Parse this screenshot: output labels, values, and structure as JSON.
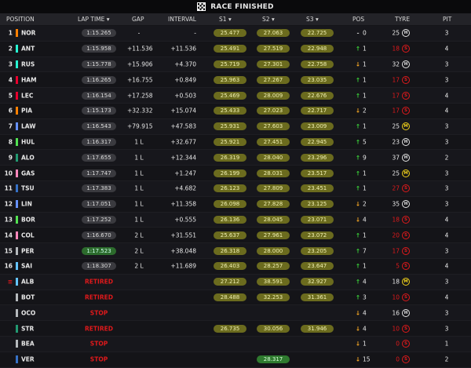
{
  "title": "RACE FINISHED",
  "headers": {
    "position": "POSITION",
    "lap_time": "LAP TIME",
    "gap": "GAP",
    "interval": "INTERVAL",
    "s1": "S1",
    "s2": "S2",
    "s3": "S3",
    "pos": "POS",
    "tyre": "TYRE",
    "pit": "PIT"
  },
  "colors": {
    "mclaren": "#ff8000",
    "ferrari": "#e8002d",
    "mercedes": "#27f4d2",
    "redbull": "#3671c6",
    "williams": "#64c4ff",
    "haas": "#b6babd",
    "alpine": "#ff87bc",
    "sauber": "#52e252",
    "astonmartin": "#229971",
    "racingbulls": "#6692ff"
  },
  "rows": [
    {
      "pos": "1",
      "code": "NOR",
      "team": "#ff8000",
      "lap": "1:15.265",
      "lap_style": "",
      "gap": "-",
      "interval": "-",
      "s1": "25.477",
      "s1c": "y",
      "s2": "27.063",
      "s2c": "y",
      "s3": "22.725",
      "s3c": "y",
      "arrow": "-",
      "dir": "none",
      "chg": "0",
      "laps": "25",
      "tyre": "H",
      "pit": "3"
    },
    {
      "pos": "2",
      "code": "ANT",
      "team": "#27f4d2",
      "lap": "1:15.958",
      "lap_style": "",
      "gap": "+11.536",
      "interval": "+11.536",
      "s1": "25.491",
      "s1c": "y",
      "s2": "27.519",
      "s2c": "y",
      "s3": "22.948",
      "s3c": "y",
      "arrow": "↑",
      "dir": "up",
      "chg": "1",
      "laps": "18",
      "tyre": "S",
      "pit": "4"
    },
    {
      "pos": "3",
      "code": "RUS",
      "team": "#27f4d2",
      "lap": "1:15.778",
      "lap_style": "",
      "gap": "+15.906",
      "interval": "+4.370",
      "s1": "25.719",
      "s1c": "y",
      "s2": "27.301",
      "s2c": "y",
      "s3": "22.758",
      "s3c": "y",
      "arrow": "↓",
      "dir": "down",
      "chg": "1",
      "laps": "32",
      "tyre": "H",
      "pit": "3"
    },
    {
      "pos": "4",
      "code": "HAM",
      "team": "#e8002d",
      "lap": "1:16.265",
      "lap_style": "",
      "gap": "+16.755",
      "interval": "+0.849",
      "s1": "25.963",
      "s1c": "y",
      "s2": "27.267",
      "s2c": "y",
      "s3": "23.035",
      "s3c": "y",
      "arrow": "↑",
      "dir": "up",
      "chg": "1",
      "laps": "17",
      "tyre": "S",
      "pit": "3"
    },
    {
      "pos": "5",
      "code": "LEC",
      "team": "#e8002d",
      "lap": "1:16.154",
      "lap_style": "",
      "gap": "+17.258",
      "interval": "+0.503",
      "s1": "25.469",
      "s1c": "y",
      "s2": "28.009",
      "s2c": "y",
      "s3": "22.676",
      "s3c": "y",
      "arrow": "↑",
      "dir": "up",
      "chg": "1",
      "laps": "17",
      "tyre": "S",
      "pit": "4"
    },
    {
      "pos": "6",
      "code": "PIA",
      "team": "#ff8000",
      "lap": "1:15.173",
      "lap_style": "",
      "gap": "+32.332",
      "interval": "+15.074",
      "s1": "25.433",
      "s1c": "y",
      "s2": "27.023",
      "s2c": "y",
      "s3": "22.717",
      "s3c": "y",
      "arrow": "↓",
      "dir": "down",
      "chg": "2",
      "laps": "17",
      "tyre": "S",
      "pit": "4"
    },
    {
      "pos": "7",
      "code": "LAW",
      "team": "#6692ff",
      "lap": "1:16.543",
      "lap_style": "",
      "gap": "+79.915",
      "interval": "+47.583",
      "s1": "25.931",
      "s1c": "y",
      "s2": "27.603",
      "s2c": "y",
      "s3": "23.009",
      "s3c": "y",
      "arrow": "↑",
      "dir": "up",
      "chg": "1",
      "laps": "25",
      "tyre": "M",
      "pit": "3"
    },
    {
      "pos": "8",
      "code": "HUL",
      "team": "#52e252",
      "lap": "1:16.317",
      "lap_style": "",
      "gap": "1 L",
      "interval": "+32.677",
      "s1": "25.921",
      "s1c": "y",
      "s2": "27.451",
      "s2c": "y",
      "s3": "22.945",
      "s3c": "y",
      "arrow": "↑",
      "dir": "up",
      "chg": "5",
      "laps": "23",
      "tyre": "H",
      "pit": "3"
    },
    {
      "pos": "9",
      "code": "ALO",
      "team": "#229971",
      "lap": "1:17.655",
      "lap_style": "",
      "gap": "1 L",
      "interval": "+12.344",
      "s1": "26.319",
      "s1c": "y",
      "s2": "28.040",
      "s2c": "y",
      "s3": "23.296",
      "s3c": "y",
      "arrow": "↑",
      "dir": "up",
      "chg": "9",
      "laps": "37",
      "tyre": "H",
      "pit": "2"
    },
    {
      "pos": "10",
      "code": "GAS",
      "team": "#ff87bc",
      "lap": "1:17.747",
      "lap_style": "",
      "gap": "1 L",
      "interval": "+1.247",
      "s1": "26.199",
      "s1c": "y",
      "s2": "28.031",
      "s2c": "y",
      "s3": "23.517",
      "s3c": "y",
      "arrow": "↑",
      "dir": "up",
      "chg": "1",
      "laps": "25",
      "tyre": "M",
      "pit": "3"
    },
    {
      "pos": "11",
      "code": "TSU",
      "team": "#3671c6",
      "lap": "1:17.383",
      "lap_style": "",
      "gap": "1 L",
      "interval": "+4.682",
      "s1": "26.123",
      "s1c": "y",
      "s2": "27.809",
      "s2c": "y",
      "s3": "23.451",
      "s3c": "y",
      "arrow": "↑",
      "dir": "up",
      "chg": "1",
      "laps": "27",
      "tyre": "S",
      "pit": "3"
    },
    {
      "pos": "12",
      "code": "LIN",
      "team": "#6692ff",
      "lap": "1:17.051",
      "lap_style": "",
      "gap": "1 L",
      "interval": "+11.358",
      "s1": "26.098",
      "s1c": "y",
      "s2": "27.828",
      "s2c": "y",
      "s3": "23.125",
      "s3c": "y",
      "arrow": "↓",
      "dir": "down",
      "chg": "2",
      "laps": "35",
      "tyre": "H",
      "pit": "3"
    },
    {
      "pos": "13",
      "code": "BOR",
      "team": "#52e252",
      "lap": "1:17.252",
      "lap_style": "",
      "gap": "1 L",
      "interval": "+0.555",
      "s1": "26.136",
      "s1c": "y",
      "s2": "28.045",
      "s2c": "y",
      "s3": "23.071",
      "s3c": "y",
      "arrow": "↓",
      "dir": "down",
      "chg": "4",
      "laps": "18",
      "tyre": "S",
      "pit": "4"
    },
    {
      "pos": "14",
      "code": "COL",
      "team": "#ff87bc",
      "lap": "1:16.670",
      "lap_style": "",
      "gap": "2 L",
      "interval": "+31.551",
      "s1": "25.637",
      "s1c": "y",
      "s2": "27.961",
      "s2c": "y",
      "s3": "23.072",
      "s3c": "y",
      "arrow": "↑",
      "dir": "up",
      "chg": "1",
      "laps": "20",
      "tyre": "S",
      "pit": "4"
    },
    {
      "pos": "15",
      "code": "PER",
      "team": "#b6babd",
      "lap": "1:17.523",
      "lap_style": "fast",
      "gap": "2 L",
      "interval": "+38.048",
      "s1": "26.318",
      "s1c": "y",
      "s2": "28.000",
      "s2c": "y",
      "s3": "23.205",
      "s3c": "y",
      "arrow": "↑",
      "dir": "up",
      "chg": "7",
      "laps": "17",
      "tyre": "S",
      "pit": "3"
    },
    {
      "pos": "16",
      "code": "SAI",
      "team": "#64c4ff",
      "lap": "1:18.307",
      "lap_style": "",
      "gap": "2 L",
      "interval": "+11.689",
      "s1": "26.403",
      "s1c": "y",
      "s2": "28.257",
      "s2c": "y",
      "s3": "23.647",
      "s3c": "y",
      "arrow": "↑",
      "dir": "up",
      "chg": "1",
      "laps": "5",
      "tyre": "S",
      "pit": "4"
    },
    {
      "pos": "",
      "code": "ALB",
      "team": "#64c4ff",
      "lap": "RETIRED",
      "lap_style": "status",
      "gap": "",
      "interval": "",
      "s1": "",
      "s1c": "",
      "s2": "38.591",
      "s2c": "y",
      "s3": "32.927",
      "s3c": "y",
      "arrow": "↑",
      "dir": "up",
      "chg": "4",
      "laps": "18",
      "tyre": "M",
      "pit": "3",
      "s1v": "27.212",
      "s1vc": "y"
    },
    {
      "pos": "",
      "code": "BOT",
      "team": "#b6babd",
      "lap": "RETIRED",
      "lap_style": "status",
      "gap": "",
      "interval": "",
      "s1": "28.488",
      "s1c": "y",
      "s2": "32.253",
      "s2c": "y",
      "s3": "31.361",
      "s3c": "y",
      "arrow": "↑",
      "dir": "up",
      "chg": "3",
      "laps": "10",
      "tyre": "S",
      "pit": "4"
    },
    {
      "pos": "",
      "code": "OCO",
      "team": "#b6babd",
      "lap": "STOP",
      "lap_style": "status",
      "gap": "",
      "interval": "",
      "s1": "",
      "s1c": "",
      "s2": "",
      "s2c": "",
      "s3": "",
      "s3c": "",
      "arrow": "↓",
      "dir": "down",
      "chg": "4",
      "laps": "16",
      "tyre": "H",
      "pit": "3"
    },
    {
      "pos": "",
      "code": "STR",
      "team": "#229971",
      "lap": "RETIRED",
      "lap_style": "status",
      "gap": "",
      "interval": "",
      "s1": "26.735",
      "s1c": "y",
      "s2": "30.056",
      "s2c": "y",
      "s3": "31.946",
      "s3c": "y",
      "arrow": "↓",
      "dir": "down",
      "chg": "4",
      "laps": "10",
      "tyre": "S",
      "pit": "3"
    },
    {
      "pos": "",
      "code": "BEA",
      "team": "#b6babd",
      "lap": "STOP",
      "lap_style": "status",
      "gap": "",
      "interval": "",
      "s1": "",
      "s1c": "",
      "s2": "",
      "s2c": "",
      "s3": "",
      "s3c": "",
      "arrow": "↓",
      "dir": "down",
      "chg": "1",
      "laps": "0",
      "tyre": "S",
      "pit": "1"
    },
    {
      "pos": "",
      "code": "VER",
      "team": "#3671c6",
      "lap": "STOP",
      "lap_style": "status",
      "gap": "",
      "interval": "",
      "s1": "",
      "s1c": "",
      "s2": "28.317",
      "s2c": "g",
      "s3": "",
      "s3c": "",
      "arrow": "↓",
      "dir": "down",
      "chg": "15",
      "laps": "0",
      "tyre": "S",
      "pit": "2"
    }
  ]
}
